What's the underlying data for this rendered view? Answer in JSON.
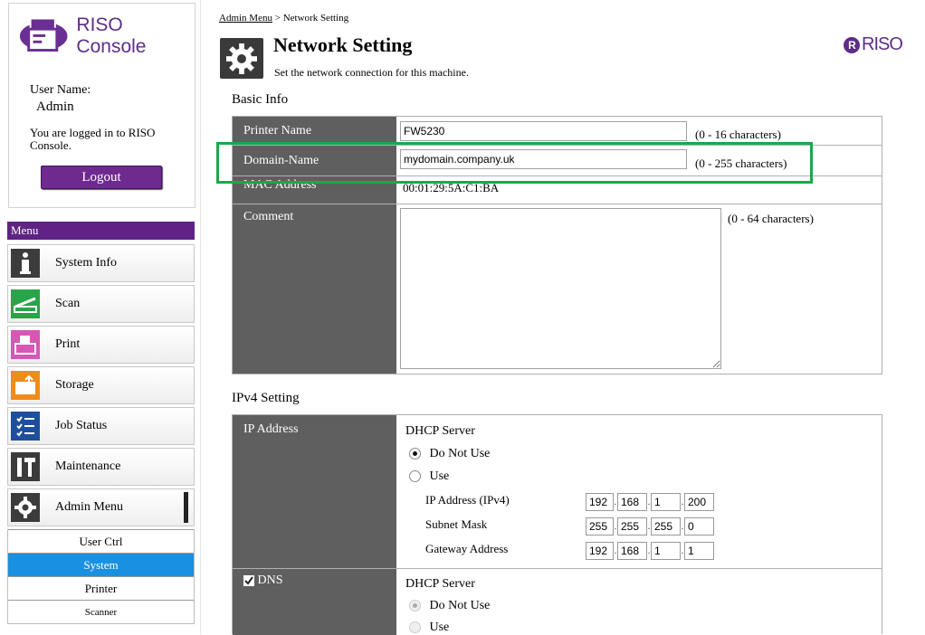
{
  "app": {
    "logo_text": "RISO Console",
    "user_label": "User Name:",
    "user_name": "Admin",
    "login_message": "You are logged in to RISO Console.",
    "logout_label": "Logout",
    "brand": "RISO"
  },
  "menu": {
    "title": "Menu",
    "items": [
      {
        "label": "System Info",
        "icon": "info-icon",
        "color": "#3c3c3c"
      },
      {
        "label": "Scan",
        "icon": "scanner-icon",
        "color": "#2aa44a"
      },
      {
        "label": "Print",
        "icon": "printer-icon",
        "color": "#d857b5"
      },
      {
        "label": "Storage",
        "icon": "folder-upload-icon",
        "color": "#f08c1b"
      },
      {
        "label": "Job Status",
        "icon": "checklist-icon",
        "color": "#1e4f9c"
      },
      {
        "label": "Maintenance",
        "icon": "tools-icon",
        "color": "#3c3c3c"
      },
      {
        "label": "Admin Menu",
        "icon": "gear-icon",
        "color": "#3c3c3c"
      }
    ],
    "sub_items": [
      "User Ctrl",
      "System",
      "Printer",
      "Scanner"
    ],
    "selected_sub": "System"
  },
  "breadcrumb": {
    "link": "Admin Menu",
    "separator": " > ",
    "current": "Network Setting"
  },
  "page": {
    "title": "Network Setting",
    "subtitle": "Set the network connection for this machine."
  },
  "basic_info": {
    "heading": "Basic Info",
    "printer_name_label": "Printer Name",
    "printer_name_value": "FW5230",
    "printer_name_hint": "(0 - 16 characters)",
    "domain_label": "Domain-Name",
    "domain_value": "mydomain.company.uk",
    "domain_hint": "(0 - 255 characters)",
    "mac_label": "MAC Address",
    "mac_value": "00:01:29:5A:C1:BA",
    "comment_label": "Comment",
    "comment_value": "",
    "comment_hint": "(0 - 64 characters)"
  },
  "ipv4": {
    "heading": "IPv4 Setting",
    "ip_label": "IP Address",
    "dhcp_label": "DHCP Server",
    "opt_do_not_use": "Do Not Use",
    "opt_use": "Use",
    "ip_field_label": "IP Address (IPv4)",
    "ip_octets": [
      "192",
      "168",
      "1",
      "200"
    ],
    "subnet_label": "Subnet Mask",
    "subnet_octets": [
      "255",
      "255",
      "255",
      "0"
    ],
    "gateway_label": "Gateway Address",
    "gateway_octets": [
      "192",
      "168",
      "1",
      "1"
    ],
    "dns_label": "DNS",
    "dns_dhcp_label": "DHCP Server",
    "dns_opt_do_not_use": "Do Not Use",
    "dns_opt_use": "Use"
  }
}
